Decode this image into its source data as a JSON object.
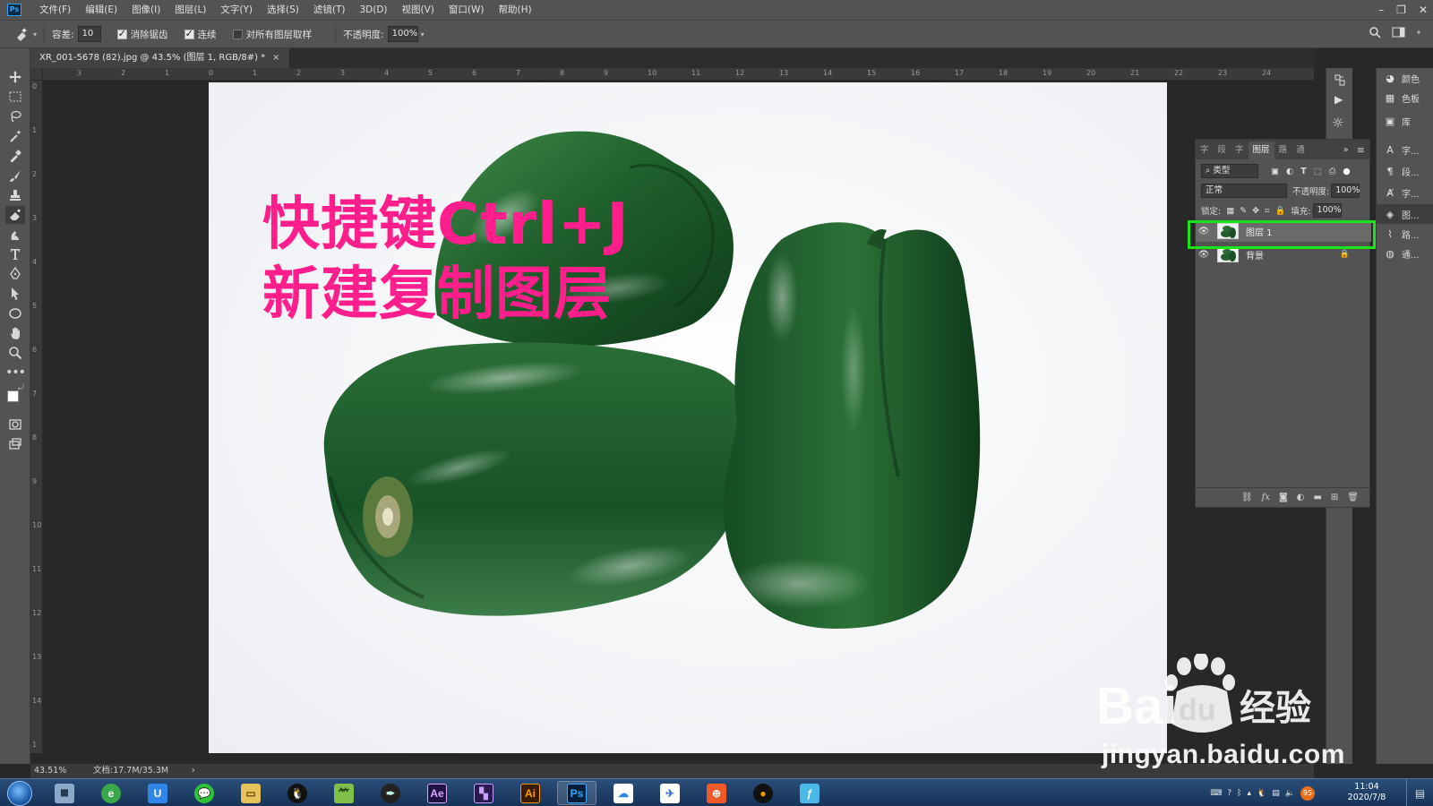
{
  "menubar": {
    "logo": "Ps",
    "items": [
      "文件(F)",
      "编辑(E)",
      "图像(I)",
      "图层(L)",
      "文字(Y)",
      "选择(S)",
      "滤镜(T)",
      "3D(D)",
      "视图(V)",
      "窗口(W)",
      "帮助(H)"
    ]
  },
  "options": {
    "tolerance_label": "容差:",
    "tolerance_value": "10",
    "antialias_label": "消除锯齿",
    "antialias_checked": true,
    "contiguous_label": "连续",
    "contiguous_checked": true,
    "sample_all_label": "对所有图层取样",
    "sample_all_checked": false,
    "opacity_label": "不透明度:",
    "opacity_value": "100%"
  },
  "document": {
    "tab_title": "XR_001-5678 (82).jpg @ 43.5% (图层 1, RGB/8#) *",
    "close": "×",
    "annotation_line1": "快捷键Ctrl+J",
    "annotation_line2": "新建复制图层",
    "annotation_color": "#ff1e8c"
  },
  "rulers": {
    "top": [
      "3",
      "2",
      "1",
      "0",
      "1",
      "2",
      "3",
      "4",
      "5",
      "6",
      "7",
      "8",
      "9",
      "10",
      "11",
      "12",
      "13",
      "14",
      "15",
      "16",
      "17",
      "18",
      "19",
      "20",
      "21",
      "22",
      "23",
      "24"
    ],
    "left": [
      "0",
      "1",
      "2",
      "3",
      "4",
      "5",
      "6",
      "7",
      "8",
      "9",
      "10",
      "11",
      "12",
      "13",
      "14",
      "1"
    ]
  },
  "status": {
    "zoom": "43.51%",
    "doc_size": "文档:17.7M/35.3M",
    "arrow": "›"
  },
  "layers_panel": {
    "tabs": [
      "字",
      "段",
      "字",
      "图层",
      "路",
      "通"
    ],
    "active_tab": "图层",
    "filter_label": "类型",
    "blend_mode": "正常",
    "opacity_label": "不透明度:",
    "opacity_value": "100%",
    "lock_label": "锁定:",
    "fill_label": "填充:",
    "fill_value": "100%",
    "layers": [
      {
        "name": "图层 1",
        "selected": true,
        "locked": false
      },
      {
        "name": "背景",
        "selected": false,
        "locked": true
      }
    ],
    "highlight_color": "#19e619",
    "footer_icons": [
      "link-icon",
      "fx-icon",
      "mask-icon",
      "adjustment-icon",
      "folder-icon",
      "new-layer-icon",
      "trash-icon"
    ]
  },
  "right_collapsed": [
    {
      "icon": "color-icon",
      "label": "颜色"
    },
    {
      "icon": "swatches-icon",
      "label": "色板"
    },
    {
      "icon": "libraries-icon",
      "label": "库"
    },
    {
      "icon": "character-icon",
      "label": "字..."
    },
    {
      "icon": "paragraph-icon",
      "label": "段..."
    },
    {
      "icon": "char-style-icon",
      "label": "字..."
    },
    {
      "icon": "layers-icon",
      "label": "图..."
    },
    {
      "icon": "paths-icon",
      "label": "路..."
    },
    {
      "icon": "channels-icon",
      "label": "通..."
    }
  ],
  "watermark": {
    "brand": "Bai",
    "brand2": "du",
    "cn": "经验",
    "url": "jingyan.baidu.com"
  },
  "taskbar": {
    "apps": [
      "calculator-icon",
      "ie-browser-icon",
      "uc-icon",
      "wechat-icon",
      "explorer-icon",
      "qq-icon",
      "bamboo-icon",
      "pen-tool-icon",
      "Ae",
      "premiere-icon",
      "Ai",
      "Ps",
      "baidu-netdisk-icon",
      "paper-plane-icon",
      "video-icon",
      "media-player-icon",
      "foxit-icon"
    ],
    "active_app": "Ps",
    "tray_temp": "95",
    "time": "11:04",
    "date": "2020/7/8"
  }
}
